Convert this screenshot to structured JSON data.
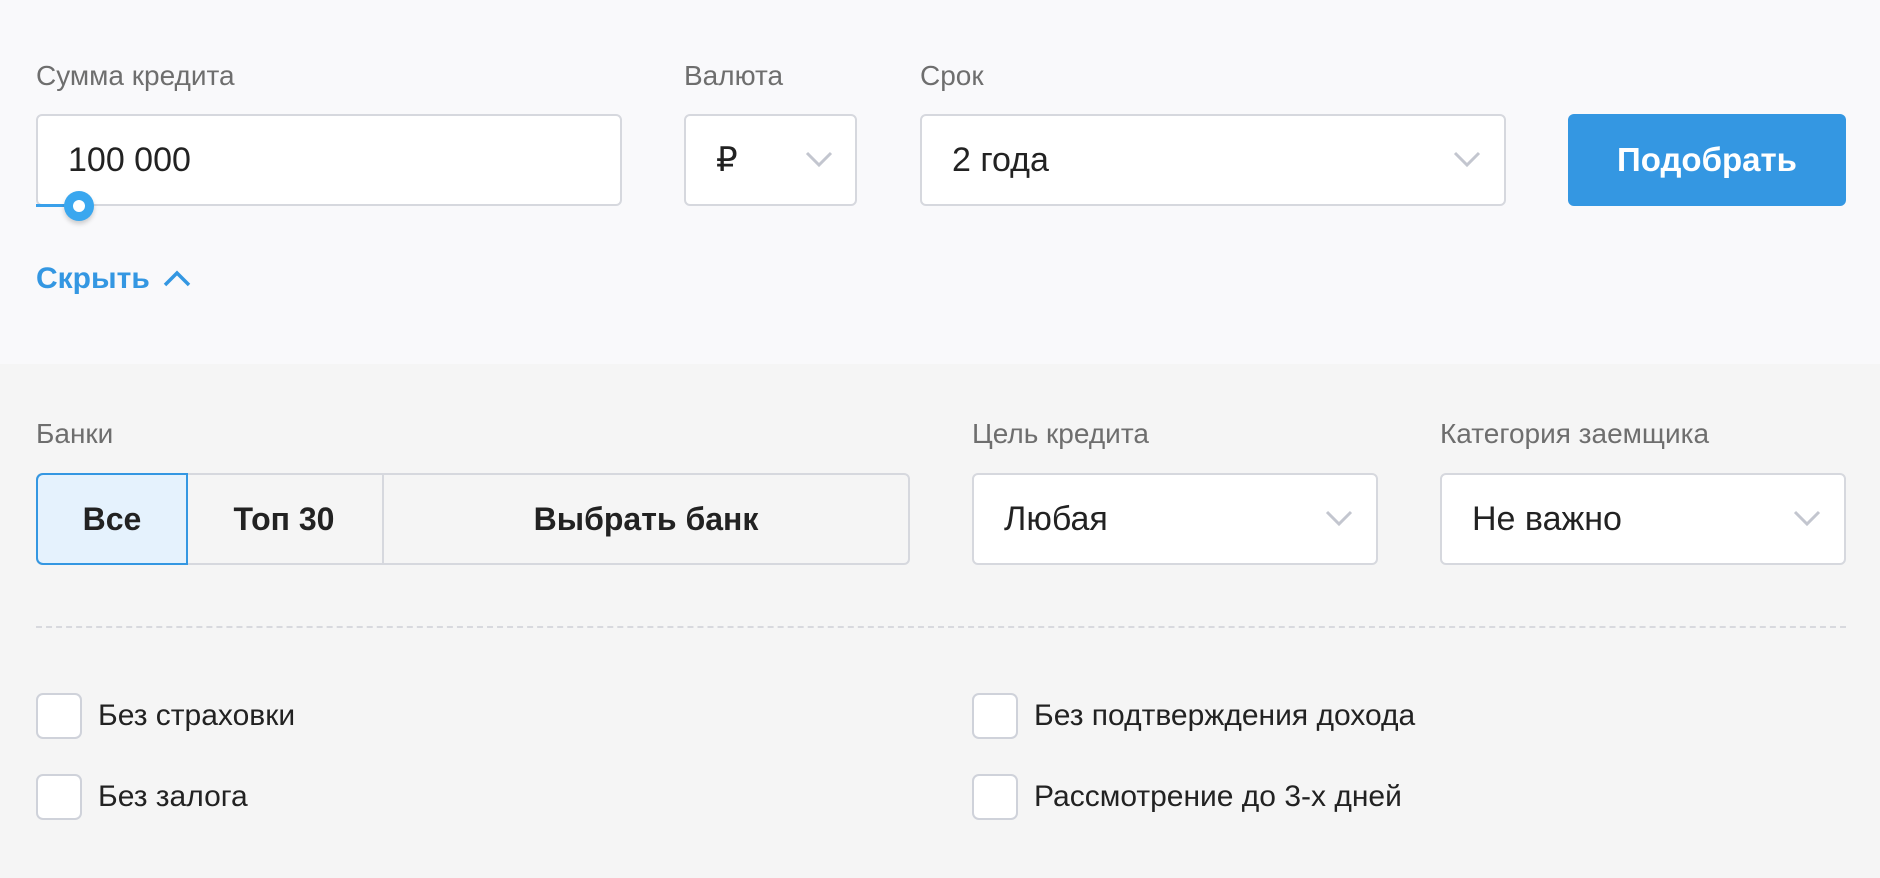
{
  "search": {
    "amount": {
      "label": "Сумма кредита",
      "value": "100 000",
      "slider_fraction": 0.04
    },
    "currency": {
      "label": "Валюта",
      "value": "₽"
    },
    "term": {
      "label": "Срок",
      "value": "2 года"
    },
    "submit_label": "Подобрать",
    "toggle_label": "Скрыть"
  },
  "filters": {
    "banks": {
      "label": "Банки",
      "options": [
        {
          "label": "Все",
          "active": true
        },
        {
          "label": "Топ 30",
          "active": false
        },
        {
          "label": "Выбрать банк",
          "active": false
        }
      ]
    },
    "purpose": {
      "label": "Цель кредита",
      "value": "Любая"
    },
    "category": {
      "label": "Категория заемщика",
      "value": "Не важно"
    },
    "checkboxes": [
      {
        "label": "Без страховки",
        "checked": false
      },
      {
        "label": "Без подтверждения дохода",
        "checked": false
      },
      {
        "label": "Без залога",
        "checked": false
      },
      {
        "label": "Рассмотрение до 3-х дней",
        "checked": false
      }
    ]
  },
  "colors": {
    "accent": "#3497e2",
    "top_bg": "#f9f9fb",
    "bottom_bg": "#f5f5f5",
    "active_segment_bg": "#e5f2fd"
  }
}
